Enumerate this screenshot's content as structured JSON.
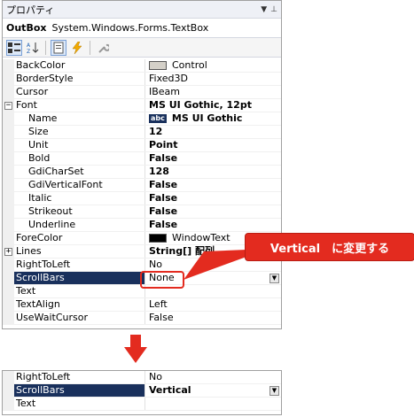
{
  "panel": {
    "title": "プロパティ",
    "title_icons": [
      "dropdown-icon",
      "pin-icon"
    ],
    "object_name": "OutBox",
    "object_type": "System.Windows.Forms.TextBox"
  },
  "toolbar": {
    "buttons": [
      "categorized-icon",
      "alphabetical-icon",
      "properties-icon",
      "events-icon",
      "property-pages-icon"
    ]
  },
  "rows": [
    {
      "name": "BackColor",
      "value": "Control",
      "swatch": "#d4d0c8"
    },
    {
      "name": "BorderStyle",
      "value": "Fixed3D"
    },
    {
      "name": "Cursor",
      "value": "IBeam"
    },
    {
      "name": "Font",
      "value": "MS UI Gothic, 12pt",
      "bold": true,
      "expander": "−"
    },
    {
      "name": "Name",
      "value": "MS UI Gothic",
      "bold": true,
      "indent": true,
      "badge": "abc"
    },
    {
      "name": "Size",
      "value": "12",
      "bold": true,
      "indent": true
    },
    {
      "name": "Unit",
      "value": "Point",
      "bold": true,
      "indent": true
    },
    {
      "name": "Bold",
      "value": "False",
      "bold": true,
      "indent": true
    },
    {
      "name": "GdiCharSet",
      "value": "128",
      "bold": true,
      "indent": true
    },
    {
      "name": "GdiVerticalFont",
      "value": "False",
      "bold": true,
      "indent": true
    },
    {
      "name": "Italic",
      "value": "False",
      "bold": true,
      "indent": true
    },
    {
      "name": "Strikeout",
      "value": "False",
      "bold": true,
      "indent": true
    },
    {
      "name": "Underline",
      "value": "False",
      "bold": true,
      "indent": true
    },
    {
      "name": "ForeColor",
      "value": "WindowText",
      "swatch": "#000000"
    },
    {
      "name": "Lines",
      "value": "String[] 配列",
      "bold": true,
      "expander": "+"
    },
    {
      "name": "RightToLeft",
      "value": "No"
    },
    {
      "name": "ScrollBars",
      "value": "None",
      "selected": true,
      "dropdown": true
    },
    {
      "name": "Text",
      "value": ""
    },
    {
      "name": "TextAlign",
      "value": "Left"
    },
    {
      "name": "UseWaitCursor",
      "value": "False"
    }
  ],
  "callout": {
    "text": "Vertical　に変更する",
    "color": "#e32b1f"
  },
  "after_rows": [
    {
      "name": "RightToLeft",
      "value": "No"
    },
    {
      "name": "ScrollBars",
      "value": "Vertical",
      "bold": true,
      "selected": true,
      "dropdown": true
    },
    {
      "name": "Text",
      "value": ""
    }
  ],
  "colors": {
    "selection": "#19305c",
    "accent_red": "#e32b1f"
  }
}
